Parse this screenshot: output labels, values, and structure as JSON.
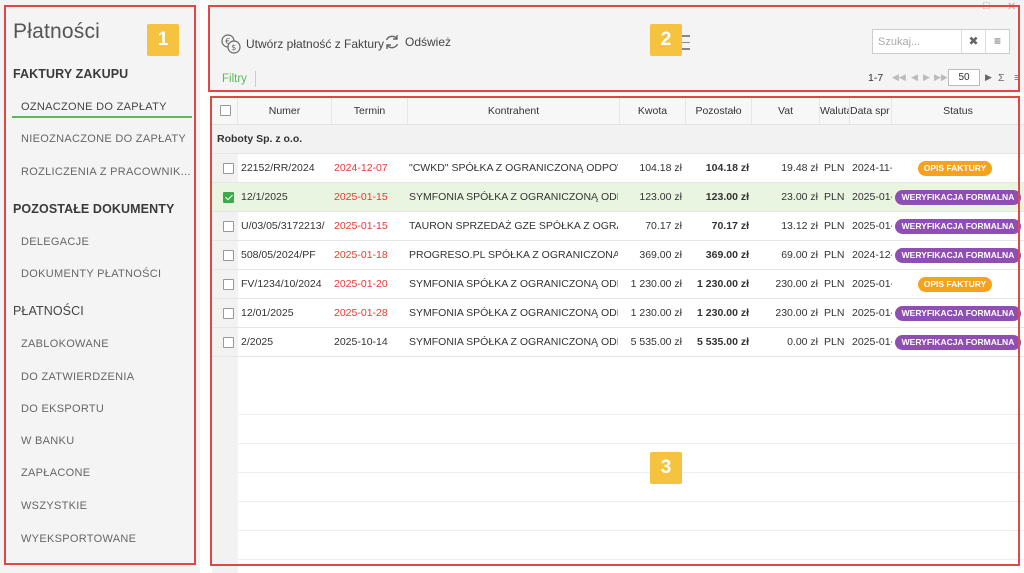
{
  "sidebar": {
    "title": "Płatności",
    "sections": [
      {
        "label": "FAKTURY ZAKUPU",
        "items": [
          "OZNACZONE DO ZAPŁATY",
          "NIEOZNACZONE DO ZAPŁATY",
          "ROZLICZENIA Z PRACOWNIK..."
        ]
      },
      {
        "label": "POZOSTAŁE DOKUMENTY",
        "items": [
          "DELEGACJE",
          "DOKUMENTY PŁATNOŚCI"
        ]
      },
      {
        "label": "PŁATNOŚCI",
        "items": [
          "ZABLOKOWANE",
          "DO ZATWIERDZENIA",
          "DO EKSPORTU",
          "W BANKU",
          "ZAPŁACONE",
          "WSZYSTKIE",
          "WYEKSPORTOWANE"
        ]
      }
    ],
    "active_item": "OZNACZONE DO ZAPŁATY"
  },
  "toolbar": {
    "create_label": "Utwórz płatność z Faktury",
    "refresh_label": "Odśwież",
    "search_placeholder": "Szukaj...",
    "filters_label": "Filtry",
    "pager_range": "1-7",
    "page_size": "50"
  },
  "annotations": {
    "sidebar": "1",
    "toolbar": "2",
    "grid": "3"
  },
  "grid": {
    "columns": [
      "Numer",
      "Termin",
      "Kontrahent",
      "Kwota",
      "Pozostało",
      "Vat",
      "Waluta",
      "Data spr",
      "Status"
    ],
    "group_label": "Roboty Sp. z o.o.",
    "rows": [
      {
        "checked": false,
        "numer": "22152/RR/2024",
        "termin": "2024-12-07",
        "termin_overdue": true,
        "kontrahent": "\"CWKD\" SPÓŁKA Z OGRANICZONĄ ODPOWIEDZIALNOŚCIĄ",
        "kwota": "104.18 zł",
        "pozostalo": "104.18 zł",
        "vat": "19.48 zł",
        "waluta": "PLN",
        "data_spr": "2024-11-",
        "status": "OPIS FAKTURY",
        "status_color": "#f5a21c"
      },
      {
        "checked": true,
        "numer": "12/1/2025",
        "termin": "2025-01-15",
        "termin_overdue": true,
        "kontrahent": "SYMFONIA SPÓŁKA Z OGRANICZONĄ ODPOWIEDZIALNOŚCIĄ",
        "kwota": "123.00 zł",
        "pozostalo": "123.00 zł",
        "vat": "23.00 zł",
        "waluta": "PLN",
        "data_spr": "2025-01-",
        "status": "WERYFIKACJA FORMALNA",
        "status_color": "#8e4eb3"
      },
      {
        "checked": false,
        "numer": "U/03/05/3172213/",
        "termin": "2025-01-15",
        "termin_overdue": true,
        "kontrahent": "TAURON SPRZEDAŻ GZE SPÓŁKA Z OGRANICZONĄ",
        "kwota": "70.17 zł",
        "pozostalo": "70.17 zł",
        "vat": "13.12 zł",
        "waluta": "PLN",
        "data_spr": "2025-01-",
        "status": "WERYFIKACJA FORMALNA",
        "status_color": "#8e4eb3"
      },
      {
        "checked": false,
        "numer": "508/05/2024/PF",
        "termin": "2025-01-18",
        "termin_overdue": true,
        "kontrahent": "PROGRESO.PL SPÓŁKA Z OGRANICZONĄ ODPOWIEDZIALNOŚCIĄ",
        "kwota": "369.00 zł",
        "pozostalo": "369.00 zł",
        "vat": "69.00 zł",
        "waluta": "PLN",
        "data_spr": "2024-12-",
        "status": "WERYFIKACJA FORMALNA",
        "status_color": "#8e4eb3"
      },
      {
        "checked": false,
        "numer": "FV/1234/10/2024",
        "termin": "2025-01-20",
        "termin_overdue": true,
        "kontrahent": "SYMFONIA SPÓŁKA Z OGRANICZONĄ ODPOWIEDZIALNOŚCIĄ",
        "kwota": "1 230.00 zł",
        "pozostalo": "1 230.00 zł",
        "vat": "230.00 zł",
        "waluta": "PLN",
        "data_spr": "2025-01-",
        "status": "OPIS FAKTURY",
        "status_color": "#f5a21c"
      },
      {
        "checked": false,
        "numer": "12/01/2025",
        "termin": "2025-01-28",
        "termin_overdue": true,
        "kontrahent": "SYMFONIA SPÓŁKA Z OGRANICZONĄ ODPOWIEDZIALNOŚCIĄ",
        "kwota": "1 230.00 zł",
        "pozostalo": "1 230.00 zł",
        "vat": "230.00 zł",
        "waluta": "PLN",
        "data_spr": "2025-01-",
        "status": "WERYFIKACJA FORMALNA",
        "status_color": "#8e4eb3"
      },
      {
        "checked": false,
        "numer": "2/2025",
        "termin": "2025-10-14",
        "termin_overdue": false,
        "kontrahent": "SYMFONIA SPÓŁKA Z OGRANICZONĄ ODPOWIEDZIALNOŚCIĄ",
        "kwota": "5 535.00 zł",
        "pozostalo": "5 535.00 zł",
        "vat": "0.00 zł",
        "waluta": "PLN",
        "data_spr": "2025-01-",
        "status": "WERYFIKACJA FORMALNA",
        "status_color": "#8e4eb3"
      }
    ]
  }
}
